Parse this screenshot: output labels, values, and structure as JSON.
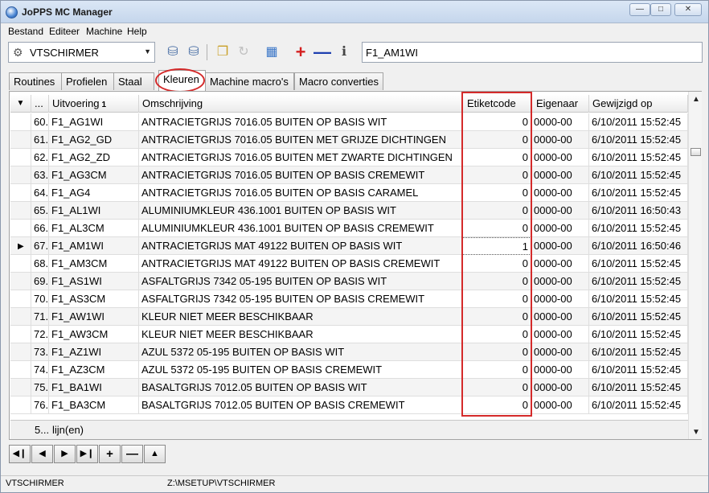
{
  "window": {
    "title": "JoPPS MC Manager"
  },
  "menu": [
    "Bestand",
    "Editeer",
    "Machine",
    "Help"
  ],
  "toolbar": {
    "machine_value": "VTSCHIRMER",
    "search_value": "F1_AM1WI"
  },
  "tabs": [
    "Routines",
    "Profielen",
    "Staal",
    "Kleuren",
    "Machine macro's",
    "Macro converties"
  ],
  "active_tab": "Kleuren",
  "grid": {
    "columns": [
      "...",
      "Uitvoering",
      "Omschrijving",
      "Etiketcode",
      "Eigenaar",
      "Gewijzigd op"
    ],
    "sort_badge": "1",
    "rows": [
      [
        "60.",
        "F1_AG1WI",
        "ANTRACIETGRIJS 7016.05 BUITEN OP BASIS WIT",
        "0",
        "0000-00",
        "6/10/2011 15:52:45"
      ],
      [
        "61.",
        "F1_AG2_GD",
        "ANTRACIETGRIJS 7016.05 BUITEN  MET GRIJZE DICHTINGEN",
        "0",
        "0000-00",
        "6/10/2011 15:52:45"
      ],
      [
        "62.",
        "F1_AG2_ZD",
        "ANTRACIETGRIJS 7016.05 BUITEN  MET ZWARTE DICHTINGEN",
        "0",
        "0000-00",
        "6/10/2011 15:52:45"
      ],
      [
        "63.",
        "F1_AG3CM",
        "ANTRACIETGRIJS 7016.05 BUITEN OP BASIS CREMEWIT",
        "0",
        "0000-00",
        "6/10/2011 15:52:45"
      ],
      [
        "64.",
        "F1_AG4",
        "ANTRACIETGRIJS 7016.05 BUITEN OP BASIS CARAMEL",
        "0",
        "0000-00",
        "6/10/2011 15:52:45"
      ],
      [
        "65.",
        "F1_AL1WI",
        "ALUMINIUMKLEUR 436.1001 BUITEN OP BASIS WIT",
        "0",
        "0000-00",
        "6/10/2011 16:50:43"
      ],
      [
        "66.",
        "F1_AL3CM",
        "ALUMINIUMKLEUR 436.1001 BUITEN OP BASIS CREMEWIT",
        "0",
        "0000-00",
        "6/10/2011 15:52:45"
      ],
      [
        "67.",
        "F1_AM1WI",
        "ANTRACIETGRIJS MAT 49122 BUITEN OP BASIS WIT",
        "1",
        "0000-00",
        "6/10/2011 16:50:46"
      ],
      [
        "68.",
        "F1_AM3CM",
        "ANTRACIETGRIJS MAT 49122 BUITEN OP BASIS CREMEWIT",
        "0",
        "0000-00",
        "6/10/2011 15:52:45"
      ],
      [
        "69.",
        "F1_AS1WI",
        "ASFALTGRIJS 7342 05-195 BUITEN OP BASIS WIT",
        "0",
        "0000-00",
        "6/10/2011 15:52:45"
      ],
      [
        "70.",
        "F1_AS3CM",
        "ASFALTGRIJS 7342 05-195 BUITEN OP BASIS CREMEWIT",
        "0",
        "0000-00",
        "6/10/2011 15:52:45"
      ],
      [
        "71.",
        "F1_AW1WI",
        "KLEUR NIET MEER BESCHIKBAAR",
        "0",
        "0000-00",
        "6/10/2011 15:52:45"
      ],
      [
        "72.",
        "F1_AW3CM",
        "KLEUR NIET MEER BESCHIKBAAR",
        "0",
        "0000-00",
        "6/10/2011 15:52:45"
      ],
      [
        "73.",
        "F1_AZ1WI",
        "AZUL 5372 05-195 BUITEN OP BASIS WIT",
        "0",
        "0000-00",
        "6/10/2011 15:52:45"
      ],
      [
        "74.",
        "F1_AZ3CM",
        "AZUL 5372 05-195 BUITEN OP BASIS CREMEWIT",
        "0",
        "0000-00",
        "6/10/2011 15:52:45"
      ],
      [
        "75.",
        "F1_BA1WI",
        "BASALTGRIJS 7012.05 BUITEN OP BASIS WIT",
        "0",
        "0000-00",
        "6/10/2011 15:52:45"
      ],
      [
        "76.",
        "F1_BA3CM",
        "BASALTGRIJS 7012.05 BUITEN OP BASIS CREMEWIT",
        "0",
        "0000-00",
        "6/10/2011 15:52:45"
      ]
    ],
    "selected_row": "67.",
    "footer_count": "5...",
    "footer_label": "lijn(en)"
  },
  "status": {
    "left": "VTSCHIRMER",
    "path": "Z:\\MSETUP\\VTSCHIRMER"
  },
  "colors": {
    "highlight": "#d42a2a"
  }
}
